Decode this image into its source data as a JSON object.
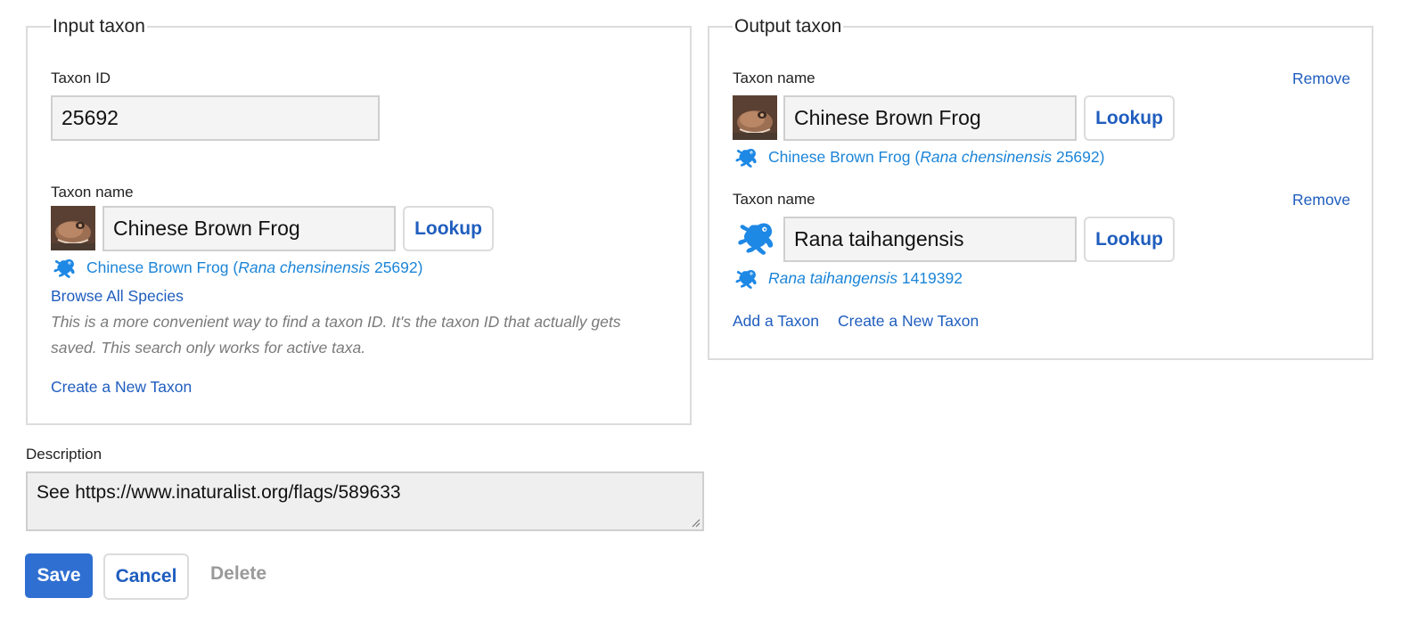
{
  "input_taxon": {
    "legend": "Input taxon",
    "taxon_id_label": "Taxon ID",
    "taxon_id_value": "25692",
    "taxon_name_label": "Taxon name",
    "taxon_name_value": "Chinese Brown Frog",
    "lookup_label": "Lookup",
    "result": {
      "common": "Chinese Brown Frog (",
      "scientific": "Rana chensinensis",
      "id": " 25692)"
    },
    "browse_label": "Browse All Species",
    "help_text": "This is a more convenient way to find a taxon ID. It's the taxon ID that actually gets saved. This search only works for active taxa.",
    "create_label": "Create a New Taxon"
  },
  "output_taxon": {
    "legend": "Output taxon",
    "items": [
      {
        "label": "Taxon name",
        "remove": "Remove",
        "value": "Chinese Brown Frog",
        "lookup": "Lookup",
        "result_common": "Chinese Brown Frog (",
        "result_scientific": "Rana chensinensis",
        "result_id": " 25692)",
        "thumb_icon": "frog-photo"
      },
      {
        "label": "Taxon name",
        "remove": "Remove",
        "value": "Rana taihangensis",
        "lookup": "Lookup",
        "result_common": "",
        "result_scientific": "Rana taihangensis",
        "result_id": " 1419392",
        "thumb_icon": "amphibia-iconic-icon"
      }
    ],
    "add_label": "Add a Taxon",
    "create_label": "Create a New Taxon"
  },
  "description": {
    "label": "Description",
    "value": "See https://www.inaturalist.org/flags/589633"
  },
  "actions": {
    "save": "Save",
    "cancel": "Cancel",
    "delete": "Delete"
  },
  "colors": {
    "link": "#1f5dbe",
    "result_link": "#1c85d8",
    "save_bg": "#2f6fd1",
    "iconic_blue": "#1e88e5"
  }
}
